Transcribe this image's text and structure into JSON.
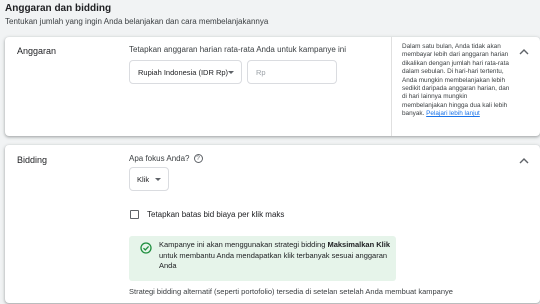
{
  "header": {
    "title": "Anggaran dan bidding",
    "subtitle": "Tentukan jumlah yang ingin Anda belanjakan dan cara membelanjakannya"
  },
  "budget": {
    "label": "Anggaran",
    "caption": "Tetapkan anggaran harian rata-rata Anda untuk kampanye ini",
    "currency_value": "Rupiah Indonesia (IDR Rp)",
    "amount_placeholder": "Rp",
    "help_text": "Dalam satu bulan, Anda tidak akan membayar lebih dari anggaran harian dikalikan dengan jumlah hari rata-rata dalam sebulan. Di hari-hari tertentu, Anda mungkin membelanjakan lebih sedikit daripada anggaran harian, dan di hari lainnya mungkin membelanjakan hingga dua kali lebih banyak.",
    "help_link": "Pelajari lebih lanjut"
  },
  "bidding": {
    "label": "Bidding",
    "focus_question": "Apa fokus Anda?",
    "help_q": "?",
    "focus_value": "Klik",
    "checkbox_label": "Tetapkan batas bid biaya per klik maks",
    "info_pre": "Kampanye ini akan menggunakan strategi bidding ",
    "info_strategy": "Maksimalkan Klik",
    "info_post": " untuk membantu Anda mendapatkan klik terbanyak sesuai anggaran Anda",
    "footnote": "Strategi bidding alternatif (seperti portofolio) tersedia di setelan setelah Anda membuat kampanye"
  },
  "colors": {
    "success_green": "#1e8e3e",
    "info_bg": "#e6f4ea",
    "link_blue": "#1a73e8"
  }
}
